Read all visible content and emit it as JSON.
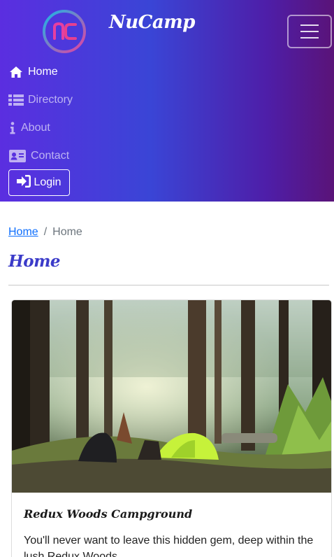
{
  "navbar": {
    "brand": "NuCamp",
    "logo_text": "nc",
    "toggler_icon": "hamburger-icon",
    "items": [
      {
        "label": "Home",
        "icon": "home-icon",
        "active": true
      },
      {
        "label": "Directory",
        "icon": "list-icon",
        "active": false
      },
      {
        "label": "About",
        "icon": "info-icon",
        "active": false
      },
      {
        "label": "Contact",
        "icon": "address-card-icon",
        "active": false
      }
    ],
    "login_label": "Login",
    "login_icon": "sign-in-icon"
  },
  "breadcrumb": {
    "link": "Home",
    "separator": "/",
    "current": "Home"
  },
  "page": {
    "title": "Home"
  },
  "card": {
    "title": "Redux Woods Campground",
    "text": "You'll never want to leave this hidden gem, deep within the lush Redux Woods."
  },
  "colors": {
    "navbar_gradient": [
      "#5b2ee0",
      "#3a45d6",
      "#4e1ea8",
      "#5a1378"
    ],
    "title_color": "#3b3bc9",
    "link_color": "#0d6efd"
  }
}
